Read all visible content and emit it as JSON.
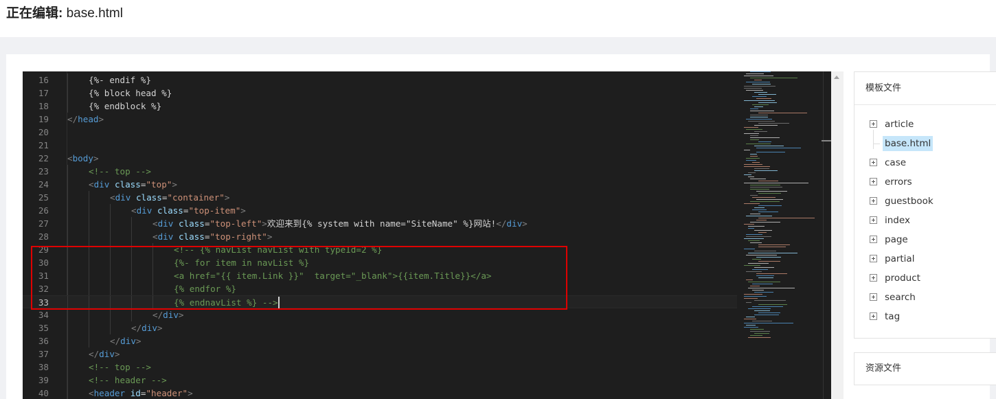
{
  "header": {
    "title_label": "正在编辑:",
    "title_file": "base.html"
  },
  "editor": {
    "lines": [
      {
        "n": "16",
        "indent": 1,
        "tokens": [
          [
            "tpl",
            "{%- endif %}"
          ]
        ]
      },
      {
        "n": "17",
        "indent": 1,
        "tokens": [
          [
            "tpl",
            "{% block head %}"
          ]
        ]
      },
      {
        "n": "18",
        "indent": 1,
        "tokens": [
          [
            "tpl",
            "{% endblock %}"
          ]
        ]
      },
      {
        "n": "19",
        "indent": 0,
        "tokens": [
          [
            "punc",
            "</"
          ],
          [
            "tag",
            "head"
          ],
          [
            "punc",
            ">"
          ]
        ]
      },
      {
        "n": "20",
        "indent": 0,
        "tokens": []
      },
      {
        "n": "21",
        "indent": 0,
        "tokens": []
      },
      {
        "n": "22",
        "indent": 0,
        "tokens": [
          [
            "punc",
            "<"
          ],
          [
            "tag",
            "body"
          ],
          [
            "punc",
            ">"
          ]
        ]
      },
      {
        "n": "23",
        "indent": 1,
        "tokens": [
          [
            "cmt",
            "<!-- top -->"
          ]
        ]
      },
      {
        "n": "24",
        "indent": 1,
        "tokens": [
          [
            "punc",
            "<"
          ],
          [
            "tag",
            "div"
          ],
          [
            "text",
            " "
          ],
          [
            "attr",
            "class"
          ],
          [
            "text",
            "="
          ],
          [
            "str",
            "\"top\""
          ],
          [
            "punc",
            ">"
          ]
        ]
      },
      {
        "n": "25",
        "indent": 2,
        "tokens": [
          [
            "punc",
            "<"
          ],
          [
            "tag",
            "div"
          ],
          [
            "text",
            " "
          ],
          [
            "attr",
            "class"
          ],
          [
            "text",
            "="
          ],
          [
            "str",
            "\"container\""
          ],
          [
            "punc",
            ">"
          ]
        ]
      },
      {
        "n": "26",
        "indent": 3,
        "tokens": [
          [
            "punc",
            "<"
          ],
          [
            "tag",
            "div"
          ],
          [
            "text",
            " "
          ],
          [
            "attr",
            "class"
          ],
          [
            "text",
            "="
          ],
          [
            "str",
            "\"top-item\""
          ],
          [
            "punc",
            ">"
          ]
        ]
      },
      {
        "n": "27",
        "indent": 4,
        "tokens": [
          [
            "punc",
            "<"
          ],
          [
            "tag",
            "div"
          ],
          [
            "text",
            " "
          ],
          [
            "attr",
            "class"
          ],
          [
            "text",
            "="
          ],
          [
            "str",
            "\"top-left\""
          ],
          [
            "punc",
            ">"
          ],
          [
            "text",
            "欢迎来到{% system with name=\"SiteName\" %}网站!"
          ],
          [
            "punc",
            "</"
          ],
          [
            "tag",
            "div"
          ],
          [
            "punc",
            ">"
          ]
        ]
      },
      {
        "n": "28",
        "indent": 4,
        "tokens": [
          [
            "punc",
            "<"
          ],
          [
            "tag",
            "div"
          ],
          [
            "text",
            " "
          ],
          [
            "attr",
            "class"
          ],
          [
            "text",
            "="
          ],
          [
            "str",
            "\"top-right\""
          ],
          [
            "punc",
            ">"
          ]
        ]
      },
      {
        "n": "29",
        "indent": 5,
        "tokens": [
          [
            "cmt",
            "<!-- {% navList navList with typeId=2 %}"
          ]
        ]
      },
      {
        "n": "30",
        "indent": 5,
        "tokens": [
          [
            "cmt",
            "{%- for item in navList %}"
          ]
        ]
      },
      {
        "n": "31",
        "indent": 5,
        "tokens": [
          [
            "cmt",
            "<a href=\"{{ item.Link }}\"  target=\"_blank\">{{item.Title}}</a>"
          ]
        ]
      },
      {
        "n": "32",
        "indent": 5,
        "tokens": [
          [
            "cmt",
            "{% endfor %}"
          ]
        ]
      },
      {
        "n": "33",
        "indent": 5,
        "tokens": [
          [
            "cmt",
            "{% endnavList %} -->"
          ]
        ],
        "current": true
      },
      {
        "n": "34",
        "indent": 4,
        "tokens": [
          [
            "punc",
            "</"
          ],
          [
            "tag",
            "div"
          ],
          [
            "punc",
            ">"
          ]
        ]
      },
      {
        "n": "35",
        "indent": 3,
        "tokens": [
          [
            "punc",
            "</"
          ],
          [
            "tag",
            "div"
          ],
          [
            "punc",
            ">"
          ]
        ]
      },
      {
        "n": "36",
        "indent": 2,
        "tokens": [
          [
            "punc",
            "</"
          ],
          [
            "tag",
            "div"
          ],
          [
            "punc",
            ">"
          ]
        ]
      },
      {
        "n": "37",
        "indent": 1,
        "tokens": [
          [
            "punc",
            "</"
          ],
          [
            "tag",
            "div"
          ],
          [
            "punc",
            ">"
          ]
        ]
      },
      {
        "n": "38",
        "indent": 1,
        "tokens": [
          [
            "cmt",
            "<!-- top -->"
          ]
        ]
      },
      {
        "n": "39",
        "indent": 1,
        "tokens": [
          [
            "cmt",
            "<!-- header -->"
          ]
        ]
      },
      {
        "n": "40",
        "indent": 1,
        "tokens": [
          [
            "punc",
            "<"
          ],
          [
            "tag",
            "header"
          ],
          [
            "text",
            " "
          ],
          [
            "attr",
            "id"
          ],
          [
            "text",
            "="
          ],
          [
            "str",
            "\"header\""
          ],
          [
            "punc",
            ">"
          ]
        ]
      }
    ],
    "highlight_color": "#e00000"
  },
  "template_panel": {
    "title": "模板文件",
    "items": [
      {
        "label": "article",
        "type": "folder"
      },
      {
        "label": "base.html",
        "type": "file",
        "selected": true
      },
      {
        "label": "case",
        "type": "folder"
      },
      {
        "label": "errors",
        "type": "folder"
      },
      {
        "label": "guestbook",
        "type": "folder"
      },
      {
        "label": "index",
        "type": "folder"
      },
      {
        "label": "page",
        "type": "folder"
      },
      {
        "label": "partial",
        "type": "folder"
      },
      {
        "label": "product",
        "type": "folder"
      },
      {
        "label": "search",
        "type": "folder"
      },
      {
        "label": "tag",
        "type": "folder"
      }
    ]
  },
  "resource_panel": {
    "title": "资源文件"
  }
}
